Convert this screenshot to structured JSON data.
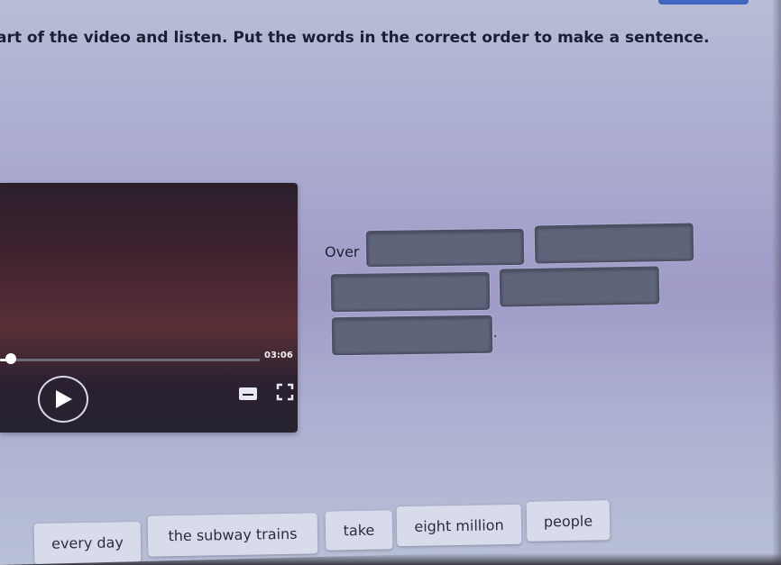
{
  "instruction": "art of the video and listen. Put the words in the correct order to make a sentence.",
  "video_player": {
    "time": "03:06",
    "progress": 0.04,
    "controls": {
      "play": "play-icon",
      "captions": "closed-captions-icon",
      "fullscreen": "fullscreen-icon"
    }
  },
  "sentence": {
    "start_word": "Over",
    "end_punctuation": ".",
    "slot_count": 5
  },
  "word_bank": [
    {
      "label": "every day"
    },
    {
      "label": "the subway trains"
    },
    {
      "label": "take"
    },
    {
      "label": "eight million"
    },
    {
      "label": "people"
    }
  ],
  "colors": {
    "accent": "#3f67c2",
    "slot_fill": "#5e6479",
    "chip_fill": "#d8dcea"
  }
}
